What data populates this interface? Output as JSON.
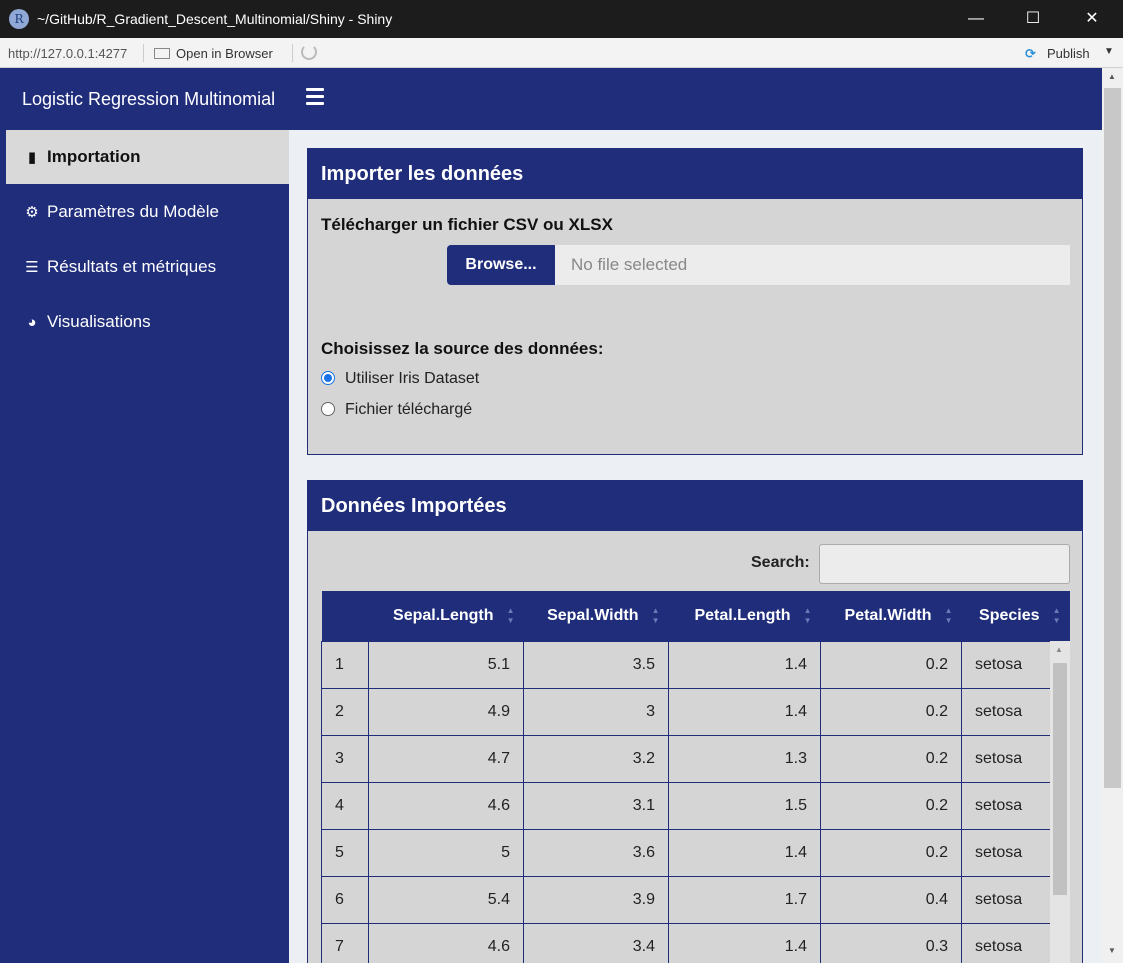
{
  "window": {
    "title": "~/GitHub/R_Gradient_Descent_Multinomial/Shiny - Shiny",
    "logo": "R",
    "minimize": "—",
    "maximize": "☐",
    "close": "✕"
  },
  "toolbar": {
    "url": "http://127.0.0.1:4277",
    "open_in_browser": "Open in Browser",
    "publish": "Publish"
  },
  "header": {
    "brand": "Logistic Regression Multinomial"
  },
  "sidebar": {
    "items": [
      {
        "label": "Importation",
        "icon": "file-import-icon",
        "active": true
      },
      {
        "label": "Paramètres du Modèle",
        "icon": "gears-icon"
      },
      {
        "label": "Résultats et métriques",
        "icon": "bar-chart-icon"
      },
      {
        "label": "Visualisations",
        "icon": "pie-chart-icon"
      }
    ]
  },
  "import_box": {
    "title": "Importer les données",
    "upload_label": "Télécharger un fichier CSV ou XLSX",
    "browse": "Browse...",
    "file_placeholder": "No file selected",
    "source_label": "Choisissez la source des données:",
    "options": [
      "Utiliser Iris Dataset",
      "Fichier téléchargé"
    ],
    "selected": "Utiliser Iris Dataset"
  },
  "data_box": {
    "title": "Données Importées",
    "search_label": "Search:",
    "columns": [
      "",
      "Sepal.Length",
      "Sepal.Width",
      "Petal.Length",
      "Petal.Width",
      "Species"
    ],
    "rows": [
      [
        "1",
        "5.1",
        "3.5",
        "1.4",
        "0.2",
        "setosa"
      ],
      [
        "2",
        "4.9",
        "3",
        "1.4",
        "0.2",
        "setosa"
      ],
      [
        "3",
        "4.7",
        "3.2",
        "1.3",
        "0.2",
        "setosa"
      ],
      [
        "4",
        "4.6",
        "3.1",
        "1.5",
        "0.2",
        "setosa"
      ],
      [
        "5",
        "5",
        "3.6",
        "1.4",
        "0.2",
        "setosa"
      ],
      [
        "6",
        "5.4",
        "3.9",
        "1.7",
        "0.4",
        "setosa"
      ],
      [
        "7",
        "4.6",
        "3.4",
        "1.4",
        "0.3",
        "setosa"
      ]
    ]
  }
}
